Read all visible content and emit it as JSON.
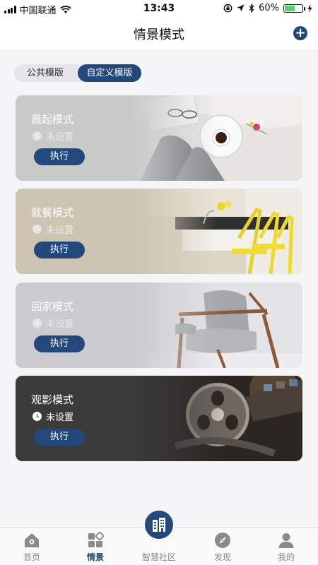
{
  "status_bar": {
    "carrier": "中国联通",
    "time": "13:43",
    "battery": "60%",
    "battery_level": 0.6
  },
  "header": {
    "title": "情景模式",
    "add_icon": "plus-circle-icon"
  },
  "tabs": [
    {
      "label": "公共模版",
      "active": false
    },
    {
      "label": "自定义模版",
      "active": true
    }
  ],
  "scenes": [
    {
      "title": "晨起模式",
      "status": "未设置",
      "action": "执行",
      "photo": "breakfast-tray-photo"
    },
    {
      "title": "就餐模式",
      "status": "未设置",
      "action": "执行",
      "photo": "dining-kitchen-photo"
    },
    {
      "title": "回家模式",
      "status": "未设置",
      "action": "执行",
      "photo": "armchair-photo"
    },
    {
      "title": "观影模式",
      "status": "未设置",
      "action": "执行",
      "photo": "film-reel-photo"
    }
  ],
  "bottom_nav": [
    {
      "label": "首页",
      "icon": "home-icon",
      "active": false
    },
    {
      "label": "情景",
      "icon": "scene-grid-icon",
      "active": true
    },
    {
      "label": "智慧社区",
      "icon": "community-buildings-icon",
      "active": false
    },
    {
      "label": "发现",
      "icon": "compass-icon",
      "active": false
    },
    {
      "label": "我的",
      "icon": "profile-icon",
      "active": false
    }
  ],
  "colors": {
    "accent": "#23497c",
    "background": "#f5f5f7",
    "battery": "#4cd964"
  }
}
